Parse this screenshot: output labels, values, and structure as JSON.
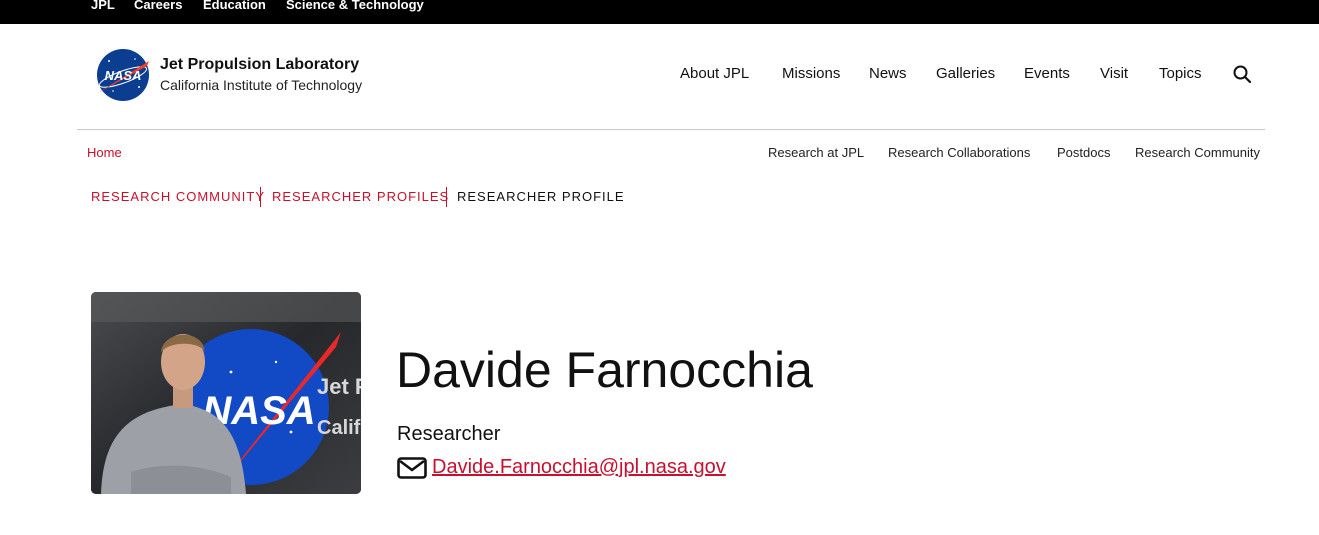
{
  "topbar": {
    "links": [
      "JPL",
      "Careers",
      "Education",
      "Science & Technology"
    ]
  },
  "logo": {
    "agency_text": "NASA",
    "title": "Jet Propulsion Laboratory",
    "subtitle": "California Institute of Technology"
  },
  "main_nav": {
    "items": [
      "About JPL",
      "Missions",
      "News",
      "Galleries",
      "Events",
      "Visit",
      "Topics"
    ],
    "search_icon": "search-icon"
  },
  "sub_nav": {
    "home": "Home",
    "items": [
      "Research at JPL",
      "Research Collaborations",
      "Postdocs",
      "Research Community"
    ]
  },
  "breadcrumb": {
    "items": [
      "RESEARCH COMMUNITY",
      "RESEARCHER PROFILES",
      "RESEARCHER PROFILE"
    ]
  },
  "profile": {
    "name": "Davide Farnocchia",
    "title": "Researcher",
    "email": "Davide.Farnocchia@jpl.nasa.gov",
    "email_icon": "envelope-icon",
    "photo_sign_text": [
      "Jet Pro",
      "Californ"
    ]
  },
  "colors": {
    "accent": "#c8102e",
    "topbar": "#000000",
    "nasa_blue": "#0b3d91"
  }
}
